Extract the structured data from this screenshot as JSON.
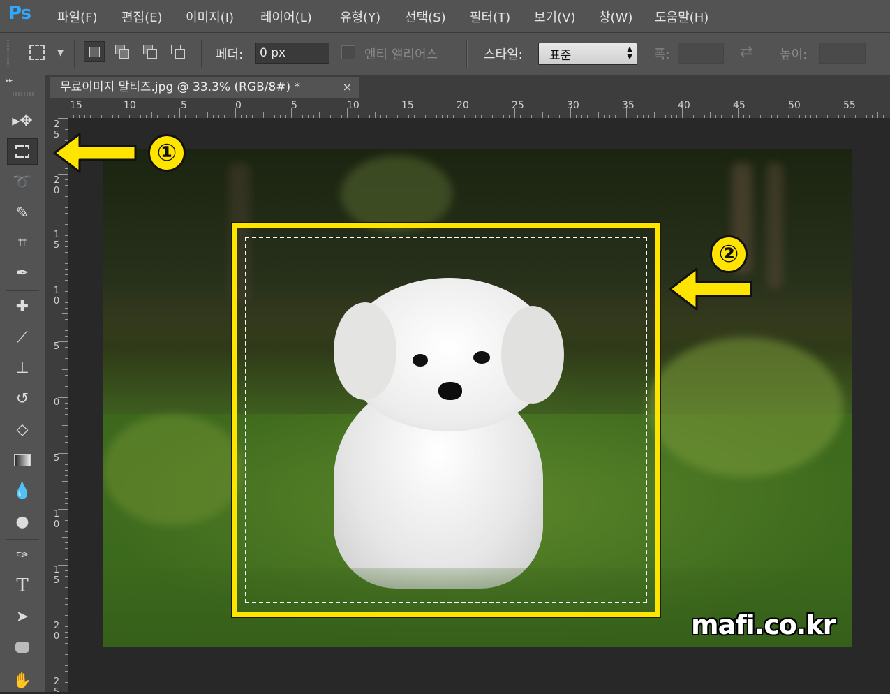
{
  "app": {
    "logo": "Ps",
    "brand_color": "#31a8ff"
  },
  "menu": [
    "파일(F)",
    "편집(E)",
    "이미지(I)",
    "레이어(L)",
    "유형(Y)",
    "선택(S)",
    "필터(T)",
    "보기(V)",
    "창(W)",
    "도움말(H)"
  ],
  "options": {
    "feather_label": "페더:",
    "feather_value": "0 px",
    "antialias_label": "앤티 앨리어스",
    "style_label": "스타일:",
    "style_value": "표준",
    "width_label": "폭:",
    "height_label": "높이:"
  },
  "document": {
    "tab_title": "무료이미지 말티즈.jpg @ 33.3% (RGB/8#) *",
    "close_glyph": "×"
  },
  "rulers": {
    "horizontal": [
      "15",
      "10",
      "5",
      "0",
      "5",
      "10",
      "15",
      "20",
      "25",
      "30",
      "35",
      "40",
      "45",
      "50",
      "55"
    ],
    "vertical": [
      "2\n5",
      "2\n0",
      "1\n5",
      "1\n0",
      "5",
      "0",
      "5",
      "1\n0",
      "1\n5",
      "2\n0",
      "2\n5"
    ]
  },
  "tools": [
    "move-tool",
    "rectangular-marquee-tool",
    "lasso-tool",
    "quick-selection-tool",
    "crop-tool",
    "eyedropper-tool",
    "healing-brush-tool",
    "brush-tool",
    "clone-stamp-tool",
    "history-brush-tool",
    "eraser-tool",
    "gradient-tool",
    "blur-tool",
    "dodge-tool",
    "pen-tool",
    "type-tool",
    "path-selection-tool",
    "rectangle-tool",
    "hand-tool"
  ],
  "annotations": {
    "badge1": "①",
    "badge2": "②",
    "color": "#ffe400"
  },
  "watermark": "mafi.co.kr"
}
